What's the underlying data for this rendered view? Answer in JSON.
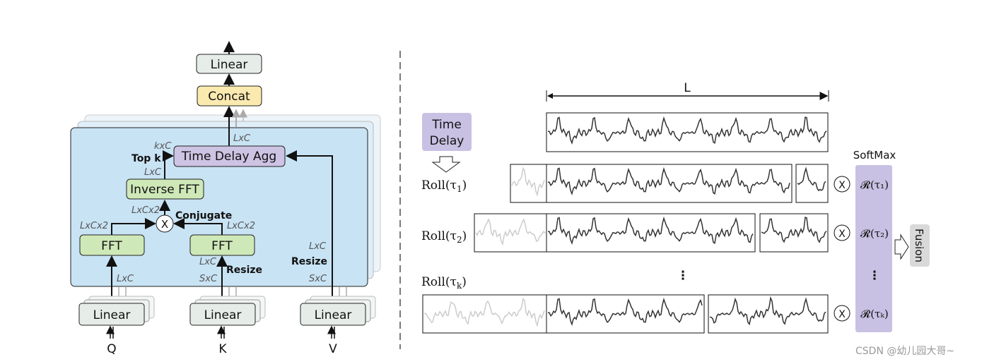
{
  "left": {
    "linear_top": "Linear",
    "concat": "Concat",
    "time_delay_agg": "Time Delay Agg",
    "inverse_fft": "Inverse FFT",
    "fft_left": "FFT",
    "fft_right": "FFT",
    "multiply": "X",
    "top_k": "Top k",
    "conjugate": "Conjugate",
    "resize_k": "Resize",
    "resize_v": "Resize",
    "dims": {
      "agg_out": "LxC",
      "kxc": "kxC",
      "ifft_out": "LxC",
      "mult_out": "LxCx2",
      "fft_left_out": "LxCx2",
      "fft_right_out": "LxCx2",
      "q_in": "LxC",
      "k_resized": "LxC",
      "k_in": "SxC",
      "v_resized": "LxC",
      "v_in": "SxC"
    },
    "linear_q": "Linear",
    "linear_k": "Linear",
    "linear_v": "Linear",
    "q": "Q",
    "k": "K",
    "v": "V",
    "colors": {
      "panel": "#c8e3f4",
      "green": "#cfe8b8",
      "purple": "#cdc3e3",
      "concat": "#fbeab0",
      "linear": "#e6ede9"
    }
  },
  "right": {
    "length_label": "L",
    "time_delay": [
      "Time",
      "Delay"
    ],
    "roll1": "Roll(τ",
    "roll1_sub": "1",
    "roll2": "Roll(τ",
    "roll2_sub": "2",
    "rollk": "Roll(τ",
    "rollk_sub": "k",
    "close_paren": ")",
    "softmax": "SoftMax",
    "r1": "𝓡(τ₁)",
    "r2": "𝓡(τ₂)",
    "rk": "𝓡(τₖ)",
    "multiply": "X",
    "vdots": "⋮",
    "fusion": "Fusion",
    "colors": {
      "softmax_bar": "#c9c1e3",
      "fusion": "#d9d9d9"
    }
  },
  "watermark": "CSDN @幼儿园大哥~"
}
